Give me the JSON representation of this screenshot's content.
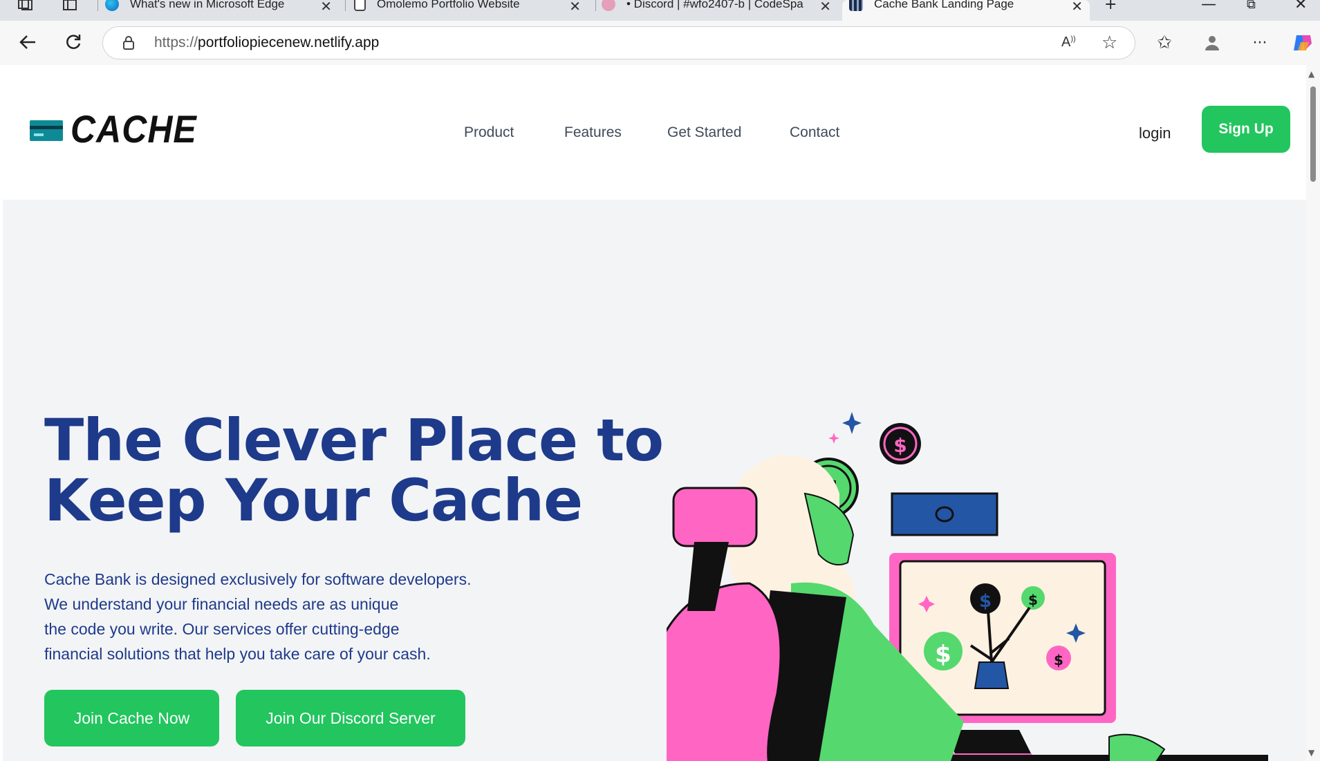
{
  "browser": {
    "tabs": [
      {
        "title": "What's new in Microsoft Edge",
        "favicon": "edge-icon"
      },
      {
        "title": "Omolemo Portfolio Website",
        "favicon": "page-icon"
      },
      {
        "title": "• Discord | #wfo2407-b | CodeSpa",
        "favicon": "discord-icon"
      },
      {
        "title": "Cache Bank Landing Page",
        "favicon": "cache-icon",
        "active": true
      }
    ],
    "url_protocol": "https://",
    "url_host": "portfoliopiecenew.netlify.app"
  },
  "site": {
    "logo_text": "CACHE",
    "nav": [
      "Product",
      "Features",
      "Get Started",
      "Contact"
    ],
    "login_label": "login",
    "signup_label": "Sign Up"
  },
  "hero": {
    "title_line1": "The Clever Place to",
    "title_line2": "Keep Your Cache",
    "description_lines": [
      "Cache Bank is designed exclusively for software developers.",
      "We understand your financial needs are as unique",
      "the code you write. Our services offer cutting-edge",
      "financial solutions that help you take care of your cash."
    ],
    "cta_primary": "Join Cache Now",
    "cta_secondary": "Join Our Discord Server"
  },
  "colors": {
    "brand_green": "#22c55e",
    "hero_blue": "#1e3a8a",
    "illus_pink": "#ff66c4",
    "illus_green": "#55d86e",
    "illus_blue": "#2456a6"
  }
}
